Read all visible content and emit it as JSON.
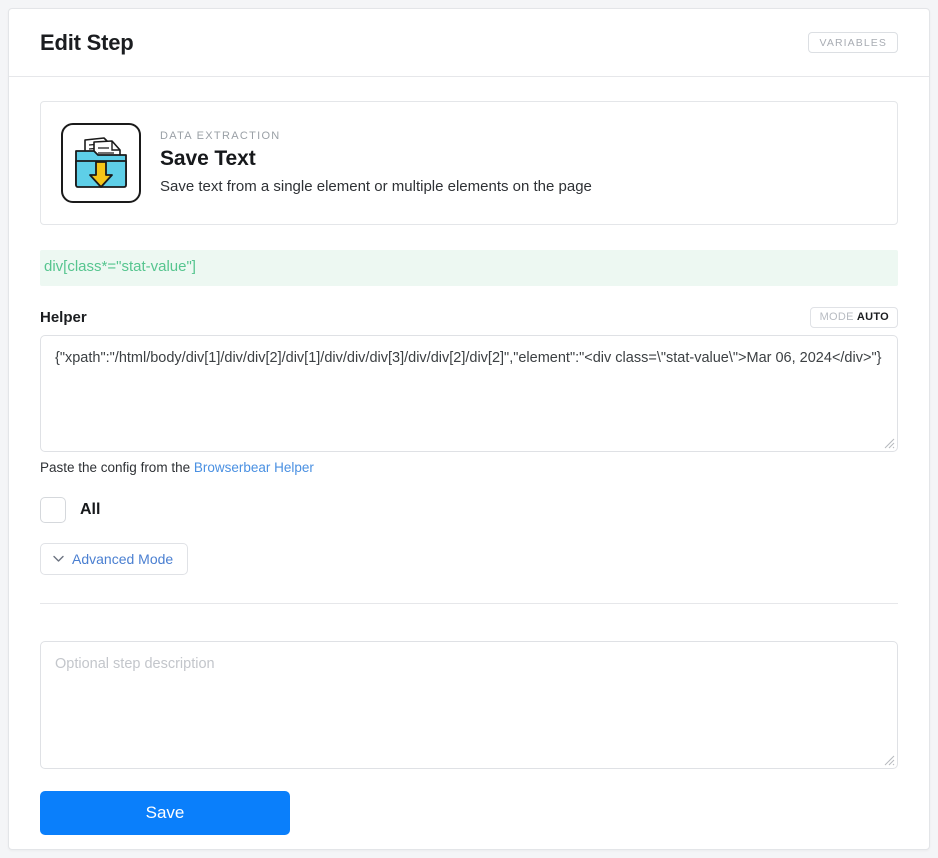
{
  "header": {
    "title": "Edit Step",
    "variables_label": "VARIABLES"
  },
  "step_type": {
    "icon": "save-text-folder-icon",
    "category": "DATA EXTRACTION",
    "name": "Save Text",
    "description": "Save text from a single element or multiple elements on the page"
  },
  "selector": {
    "value": "div[class*=\"stat-value\"]"
  },
  "helper": {
    "label": "Helper",
    "mode_key": "MODE",
    "mode_value": "AUTO",
    "value": "{\"xpath\":\"/html/body/div[1]/div/div[2]/div[1]/div/div/div[3]/div/div[2]/div[2]\",\"element\":\"<div class=\\\"stat-value\\\">Mar 06, 2024</div>\"}",
    "note_prefix": "Paste the config from the ",
    "note_link": "Browserbear Helper"
  },
  "all_option": {
    "label": "All",
    "checked": false
  },
  "advanced": {
    "label": "Advanced Mode",
    "icon": "chevron-down-icon"
  },
  "description": {
    "placeholder": "Optional step description",
    "value": ""
  },
  "actions": {
    "save_label": "Save"
  },
  "colors": {
    "accent_blue": "#0a7ffb",
    "link_blue": "#4a90e2",
    "selector_green": "#56c58f",
    "selector_bg": "#edf8f2",
    "page_bg": "#f4f5f7",
    "icon_folder": "#5ecfe8",
    "icon_arrow": "#f5c518"
  }
}
